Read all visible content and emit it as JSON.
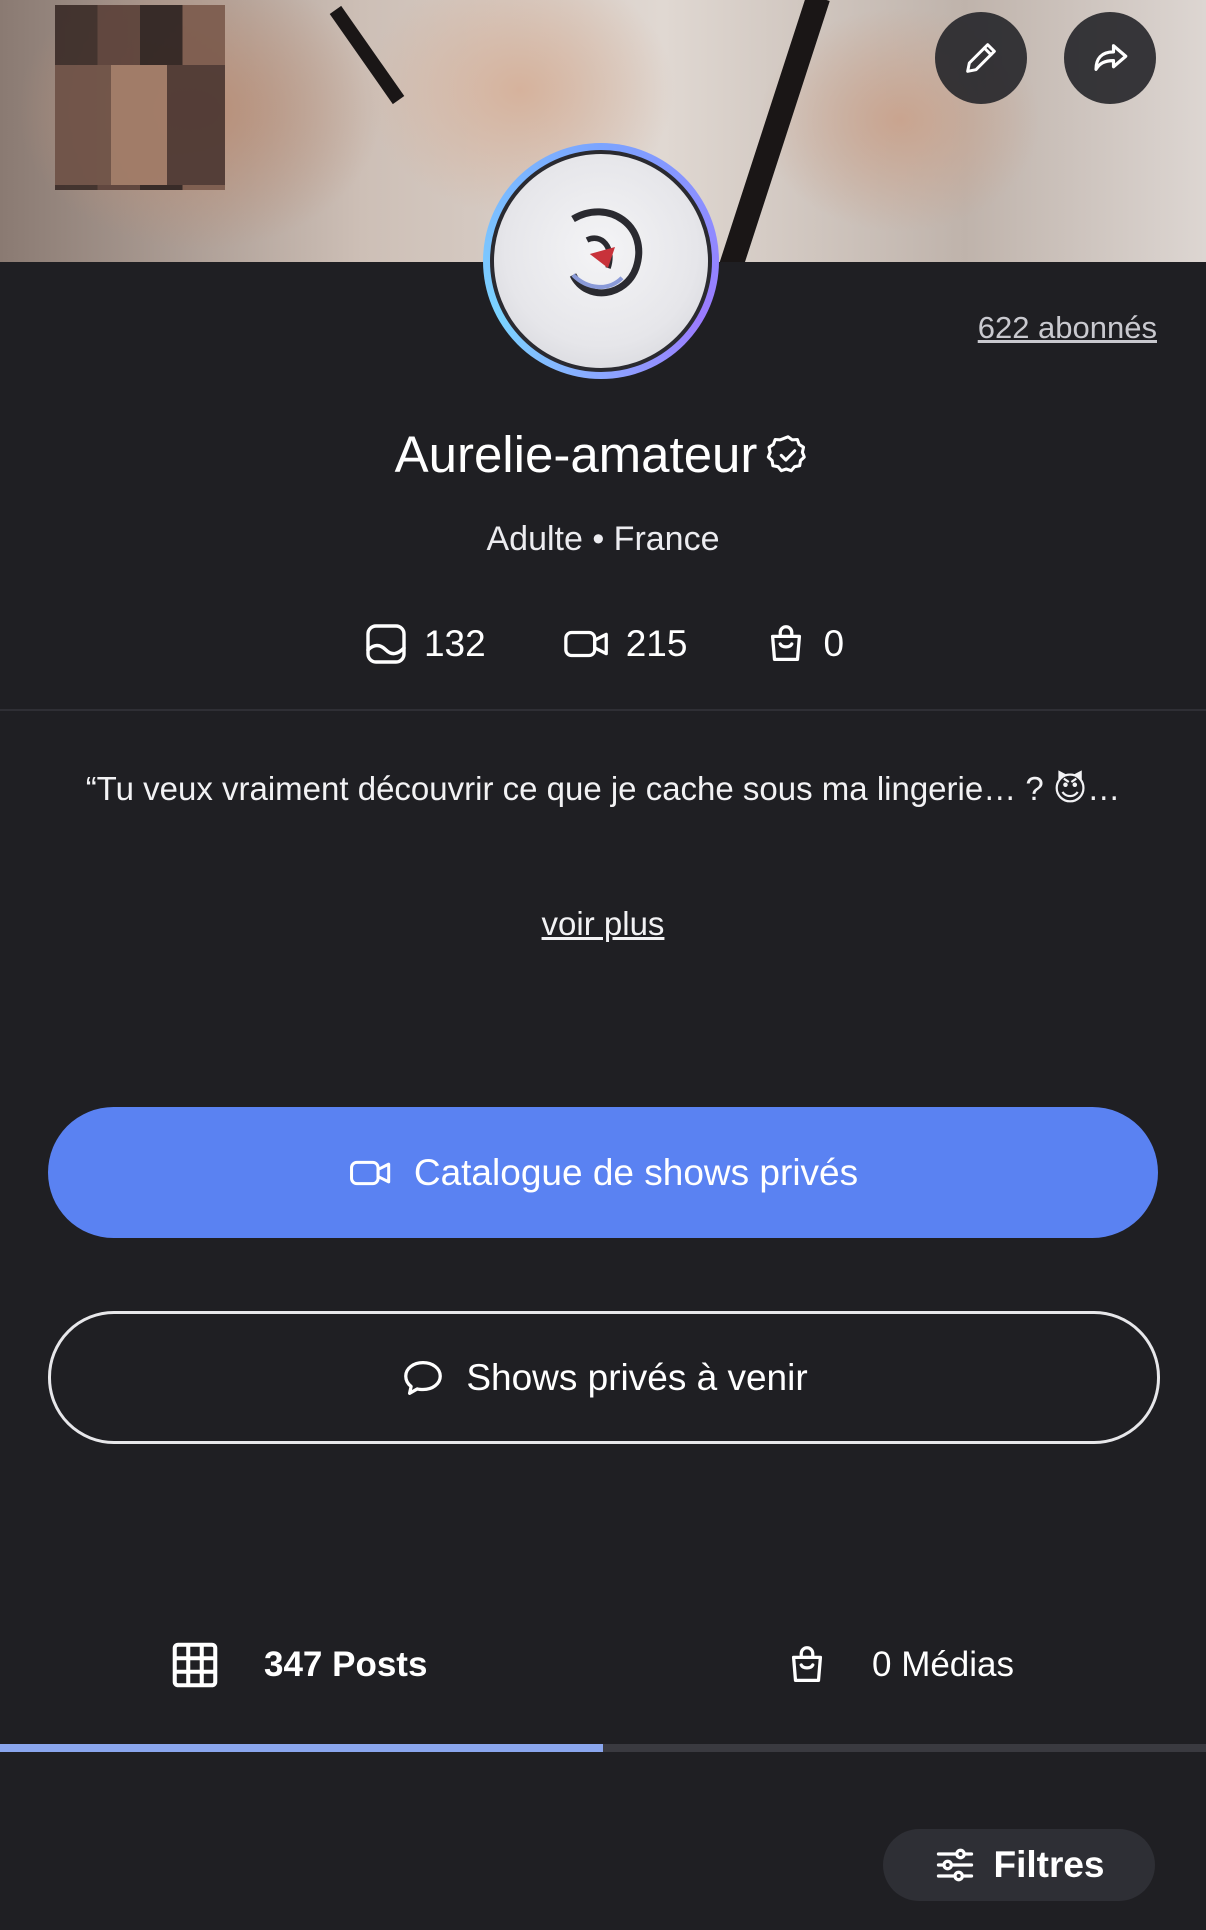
{
  "profile": {
    "subscribers": "622 abonnés",
    "name": "Aurelie-amateur",
    "meta": "Adulte • France",
    "stats": {
      "photos": "132",
      "videos": "215",
      "items": "0"
    },
    "bio": "“Tu veux vraiment découvrir ce que je cache sous ma lingerie… ? 😈…",
    "more_label": "voir plus"
  },
  "actions": {
    "catalogue_label": "Catalogue de shows privés",
    "upcoming_label": "Shows privés à venir"
  },
  "tabs": {
    "posts_label": "347 Posts",
    "medias_label": "0 Médias",
    "active_progress": 0.5
  },
  "filters_label": "Filtres",
  "icons": {
    "edit": "pencil-icon",
    "share": "share-icon",
    "verified": "verified-badge-icon",
    "photos": "image-icon",
    "videos": "video-camera-icon",
    "items": "shopping-bag-icon",
    "chat": "chat-bubble-icon",
    "grid": "grid-icon",
    "filters": "sliders-icon"
  },
  "colors": {
    "background": "#1f1f23",
    "primary": "#5a82f2",
    "tab_indicator": "#8aa6ee"
  }
}
